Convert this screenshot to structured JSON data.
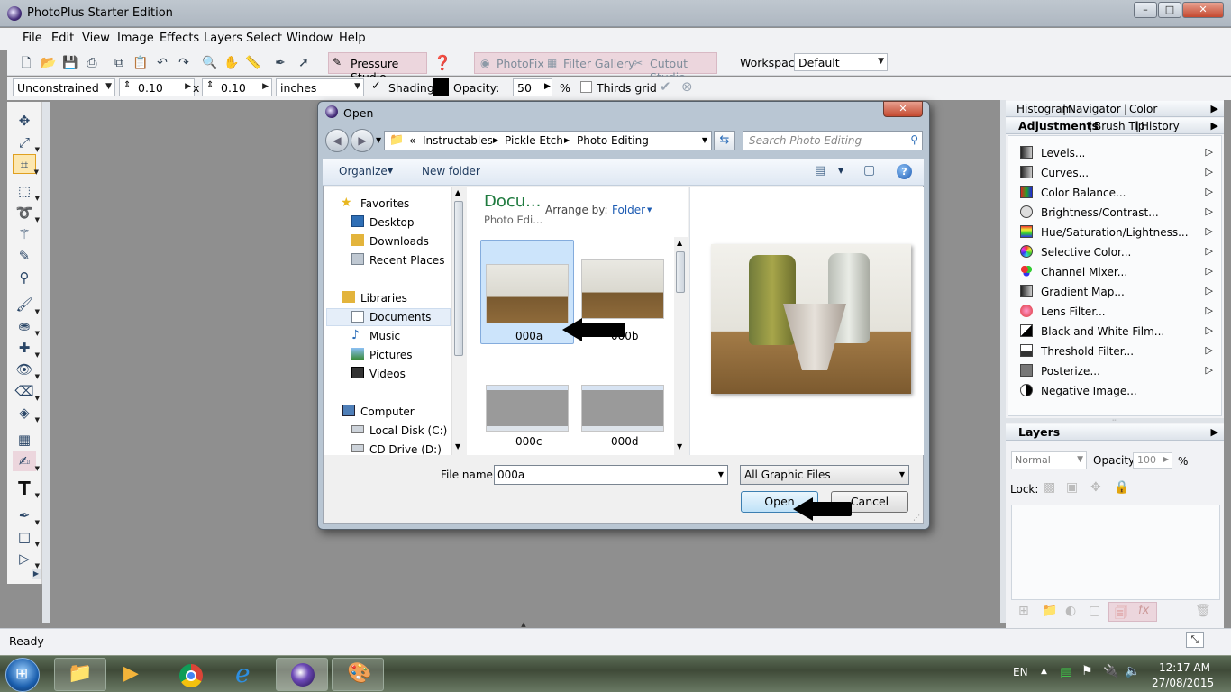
{
  "app": {
    "title": "PhotoPlus Starter Edition"
  },
  "window_buttons": {
    "minimize": "–",
    "maximize": "□",
    "close": "✕"
  },
  "menu": [
    "File",
    "Edit",
    "View",
    "Image",
    "Effects",
    "Layers",
    "Select",
    "Window",
    "Help"
  ],
  "toolbar": {
    "pressure_studio": "Pressure Studio",
    "photofix": "PhotoFix",
    "filter_gallery": "Filter Gallery",
    "cutout_studio": "Cutout Studio",
    "workspace_label": "Workspace",
    "workspace_value": "Default"
  },
  "options": {
    "mode": "Unconstrained",
    "width": "0.10",
    "x": "x",
    "height": "0.10",
    "units": "inches",
    "shading": "Shading",
    "opacity_label": "Opacity:",
    "opacity_value": "50",
    "percent": "%",
    "thirds_grid": "Thirds grid"
  },
  "right_panel": {
    "tabs_top": [
      "Histogram",
      "Navigator",
      "Color"
    ],
    "tabs_adj": [
      "Adjustments",
      "Brush Tip",
      "History"
    ],
    "adjustments": [
      "Levels...",
      "Curves...",
      "Color Balance...",
      "Brightness/Contrast...",
      "Hue/Saturation/Lightness...",
      "Selective Color...",
      "Channel Mixer...",
      "Gradient Map...",
      "Lens Filter...",
      "Black and White Film...",
      "Threshold Filter...",
      "Posterize...",
      "Negative Image..."
    ],
    "layers_title": "Layers",
    "blend_mode": "Normal",
    "opacity_label": "Opacity:",
    "opacity_value": "100",
    "percent": "%",
    "lock_label": "Lock:"
  },
  "status": "Ready",
  "taskbar": {
    "lang": "EN",
    "time": "12:17 AM",
    "date": "27/08/2015"
  },
  "dialog": {
    "title": "Open",
    "breadcrumb": [
      "«",
      "Instructables",
      "Pickle Etch",
      "Photo Editing"
    ],
    "search_placeholder": "Search Photo Editing",
    "organize": "Organize",
    "new_folder": "New folder",
    "nav": {
      "favorites": "Favorites",
      "desktop": "Desktop",
      "downloads": "Downloads",
      "recent": "Recent Places",
      "libraries": "Libraries",
      "documents": "Documents",
      "music": "Music",
      "pictures": "Pictures",
      "videos": "Videos",
      "computer": "Computer",
      "local_disk": "Local Disk (C:)",
      "cd_drive": "CD Drive (D:)"
    },
    "library_title": "Docu...",
    "library_sub": "Photo Edi...",
    "arrange_by": "Arrange by:",
    "arrange_value": "Folder",
    "files": [
      "000a",
      "000b",
      "000c",
      "000d"
    ],
    "file_name_label": "File name:",
    "file_name_value": "000a",
    "filter": "All Graphic Files",
    "open": "Open",
    "cancel": "Cancel"
  }
}
